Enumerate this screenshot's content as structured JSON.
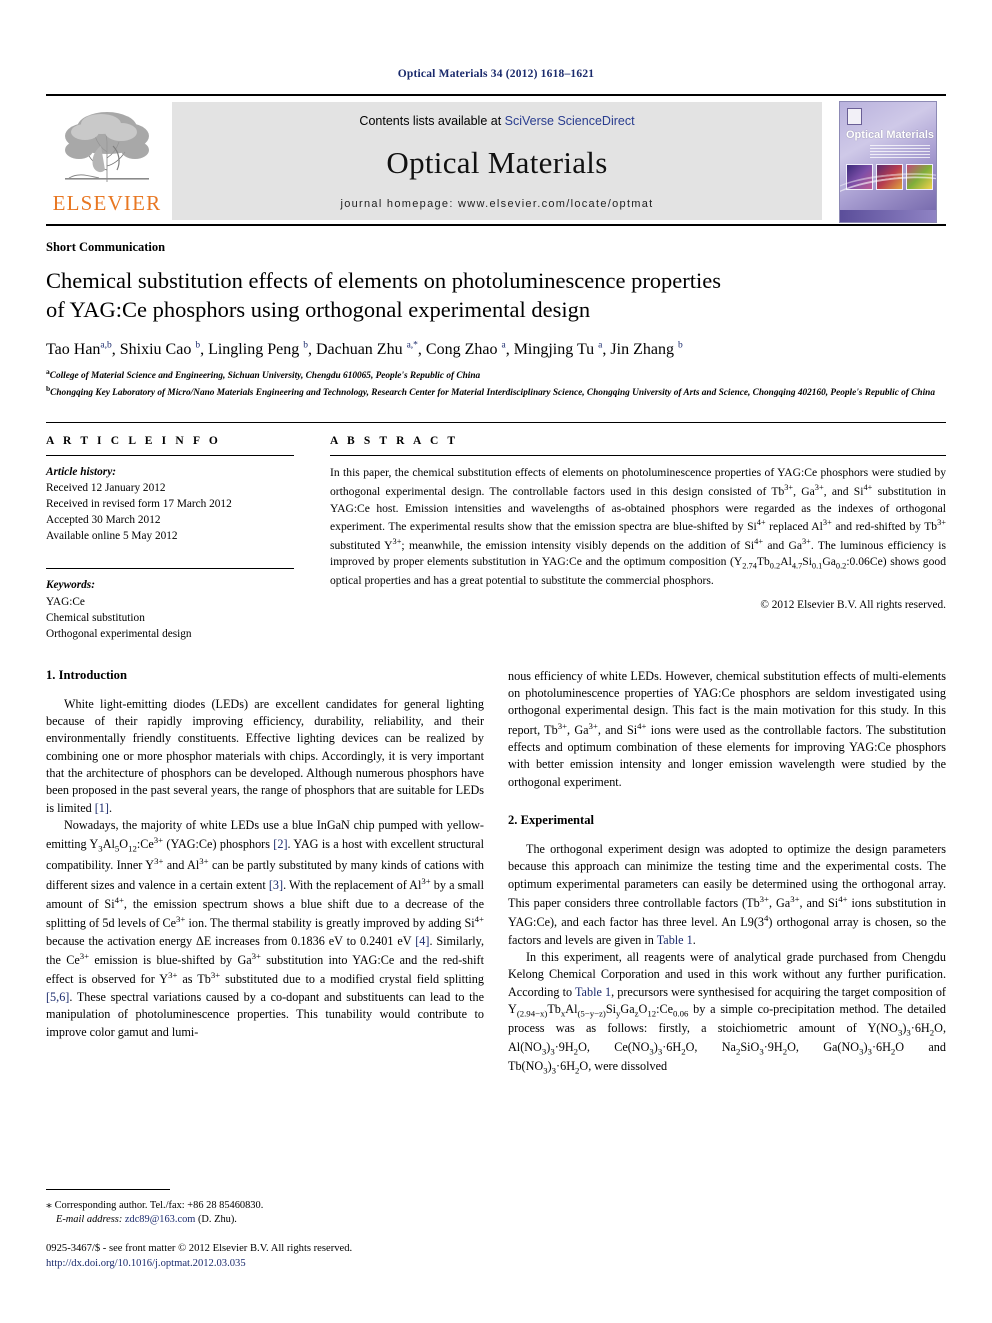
{
  "running_head": "Optical Materials 34 (2012) 1618–1621",
  "masthead": {
    "publisher_name": "ELSEVIER",
    "contents_prefix": "Contents lists available at ",
    "contents_link": "SciVerse ScienceDirect",
    "journal_name": "Optical Materials",
    "homepage": "journal homepage: www.elsevier.com/locate/optmat",
    "cover": {
      "title_word1": "Optical ",
      "title_word2": "Materials"
    }
  },
  "article": {
    "type": "Short Communication",
    "title_line1": "Chemical substitution effects of elements on photoluminescence properties",
    "title_line2": "of YAG:Ce phosphors using orthogonal experimental design",
    "authors_html": "Tao Han<sup>a,b</sup>, Shixiu Cao <sup>b</sup>, Lingling Peng <sup>b</sup>, Dachuan Zhu <sup>a,</sup><sup>*</sup>, Cong Zhao <sup>a</sup>, Mingjing Tu <sup>a</sup>, Jin Zhang <sup>b</sup>",
    "affiliation_a": "College of Material Science and Engineering, Sichuan University, Chengdu 610065, People's Republic of China",
    "affiliation_b": "Chongqing Key Laboratory of Micro/Nano Materials Engineering and Technology, Research Center for Material Interdisciplinary Science, Chongqing University of Arts and Science, Chongqing 402160, People's Republic of China"
  },
  "article_info": {
    "heading": "A R T I C L E    I N F O",
    "history_label": "Article history:",
    "history": [
      "Received 12 January 2012",
      "Received in revised form 17 March 2012",
      "Accepted 30 March 2012",
      "Available online 5 May 2012"
    ],
    "keywords_label": "Keywords:",
    "keywords": [
      "YAG:Ce",
      "Chemical substitution",
      "Orthogonal experimental design"
    ]
  },
  "abstract": {
    "heading": "A B S T R A C T",
    "text_html": "In this paper, the chemical substitution effects of elements on photoluminescence properties of YAG:Ce phosphors were studied by orthogonal experimental design. The controllable factors used in this design consisted of Tb<sup class=\"chg\">3+</sup>, Ga<sup class=\"chg\">3+</sup>, and Si<sup class=\"chg\">4+</sup> substitution in YAG:Ce host. Emission intensities and wavelengths of as-obtained phosphors were regarded as the indexes of orthogonal experiment. The experimental results show that the emission spectra are blue-shifted by Si<sup class=\"chg\">4+</sup> replaced Al<sup class=\"chg\">3+</sup> and red-shifted by Tb<sup class=\"chg\">3+</sup> substituted Y<sup class=\"chg\">3+</sup>; meanwhile, the emission intensity visibly depends on the addition of Si<sup class=\"chg\">4+</sup> and Ga<sup class=\"chg\">3+</sup>. The luminous efficiency is improved by proper elements substitution in YAG:Ce and the optimum composition (Y<sub>2.74</sub>Tb<sub>0.2</sub>Al<sub>4.7</sub>Si<sub>0.1</sub>Ga<sub>0.2</sub>:0.06Ce) shows good optical properties and has a great potential to substitute the commercial phosphors.",
    "copyright": "© 2012 Elsevier B.V. All rights reserved."
  },
  "sections": {
    "intro_heading": "1. Introduction",
    "intro_p1_html": "White light-emitting diodes (LEDs) are excellent candidates for general lighting because of their rapidly improving efficiency, durability, reliability, and their environmentally friendly constituents. Effective lighting devices can be realized by combining one or more phosphor materials with chips. Accordingly, it is very important that the architecture of phosphors can be developed. Although numerous phosphors have been proposed in the past several years, the range of phosphors that are suitable for LEDs is limited <span class=\"ref\">[1]</span>.",
    "intro_p2_html": "Nowadays, the majority of white LEDs use a blue InGaN chip pumped with yellow-emitting Y<sub>3</sub>Al<sub>5</sub>O<sub>12</sub>:Ce<sup class=\"chg\">3+</sup> (YAG:Ce) phosphors <span class=\"ref\">[2]</span>. YAG is a host with excellent structural compatibility. Inner Y<sup class=\"chg\">3+</sup> and Al<sup class=\"chg\">3+</sup> can be partly substituted by many kinds of cations with different sizes and valence in a certain extent <span class=\"ref\">[3]</span>. With the replacement of Al<sup class=\"chg\">3+</sup> by a small amount of Si<sup class=\"chg\">4+</sup>, the emission spectrum shows a blue shift due to a decrease of the splitting of 5d levels of Ce<sup class=\"chg\">3+</sup> ion. The thermal stability is greatly improved by adding Si<sup class=\"chg\">4+</sup> because the activation energy ΔE increases from 0.1836 eV to 0.2401 eV <span class=\"ref\">[4]</span>. Similarly, the Ce<sup class=\"chg\">3+</sup> emission is blue-shifted by Ga<sup class=\"chg\">3+</sup> substitution into YAG:Ce and the red-shift effect is observed for Y<sup class=\"chg\">3+</sup> as Tb<sup class=\"chg\">3+</sup> substituted due to a modified crystal field splitting <span class=\"ref\">[5,6]</span>. These spectral variations caused by a co-dopant and substituents can lead to the manipulation of photoluminescence properties. This tunability would contribute to improve color gamut and lumi-",
    "intro_p2_cont_html": "nous efficiency of white LEDs. However, chemical substitution effects of multi-elements on photoluminescence properties of YAG:Ce phosphors are seldom investigated using orthogonal experimental design. This fact is the main motivation for this study. In this report, Tb<sup class=\"chg\">3+</sup>, Ga<sup class=\"chg\">3+</sup>, and Si<sup class=\"chg\">4+</sup> ions were used as the controllable factors. The substitution effects and optimum combination of these elements for improving YAG:Ce phosphors with better emission intensity and longer emission wavelength were studied by the orthogonal experiment.",
    "exp_heading": "2. Experimental",
    "exp_p1_html": "The orthogonal experiment design was adopted to optimize the design parameters because this approach can minimize the testing time and the experimental costs. The optimum experimental parameters can easily be determined using the orthogonal array. This paper considers three controllable factors (Tb<sup class=\"chg\">3+</sup>, Ga<sup class=\"chg\">3+</sup>, and Si<sup class=\"chg\">4+</sup> ions substitution in YAG:Ce), and each factor has three level. An L9(3<sup class=\"chg\">4</sup>) orthogonal array is chosen, so the factors and levels are given in <span class=\"lnk\">Table 1</span>.",
    "exp_p2_html": "In this experiment, all reagents were of analytical grade purchased from Chengdu Kelong Chemical Corporation and used in this work without any further purification. According to <span class=\"lnk\">Table 1</span>, precursors were synthesised for acquiring the target composition of Y<sub>(2.94−x)</sub>Tb<sub>x</sub>Al<sub>(5−y−z)</sub>Si<sub>y</sub>Ga<sub>z</sub>O<sub>12</sub>:Ce<sub>0.06</sub> by a simple co-precipitation method. The detailed process was as follows: firstly, a stoichiometric amount of Y(NO<sub>3</sub>)<sub>3</sub>·6H<sub>2</sub>O, Al(NO<sub>3</sub>)<sub>3</sub>·9H<sub>2</sub>O, Ce(NO<sub>3</sub>)<sub>3</sub>·6H<sub>2</sub>O, Na<sub>2</sub>SiO<sub>3</sub>·9H<sub>2</sub>O, Ga(NO<sub>3</sub>)<sub>3</sub>·6H<sub>2</sub>O and Tb(NO<sub>3</sub>)<sub>3</sub>·6H<sub>2</sub>O, were dissolved"
  },
  "footer": {
    "corresponding_html": "<span style=\"font-size:12px;\">⁎</span> Corresponding author. Tel./fax: +86 28 85460830.",
    "email_label": "E-mail address:",
    "email": "zdc89@163.com",
    "email_suffix": " (D. Zhu).",
    "issn_line": "0925-3467/$ - see front matter © 2012 Elsevier B.V. All rights reserved.",
    "doi": "http://dx.doi.org/10.1016/j.optmat.2012.03.035"
  }
}
